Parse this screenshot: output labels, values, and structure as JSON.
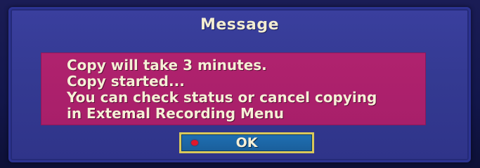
{
  "dialog": {
    "title": "Message",
    "lines": [
      "Copy will take 3 minutes.",
      "Copy started...",
      "You can check status or cancel copying",
      "in Extemal Recording Menu"
    ],
    "ok_label": "OK",
    "ok_icon": "red-button-icon"
  },
  "colors": {
    "dialog_bg": "#343a92",
    "message_bg": "#a81f6a",
    "button_bg": "#1a5f9b",
    "button_border": "#d9c85a",
    "text": "#f6efd6",
    "red_dot": "#e0182c"
  }
}
